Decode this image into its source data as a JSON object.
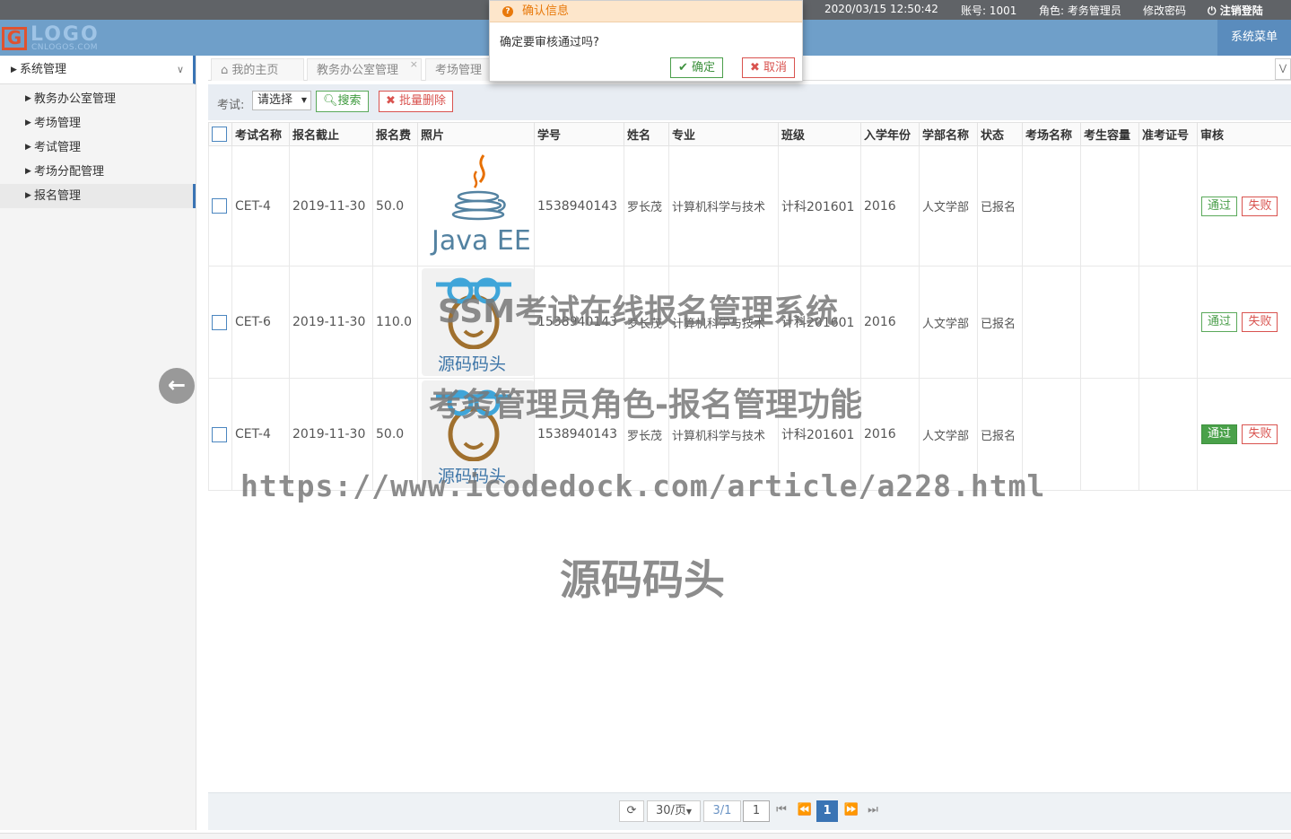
{
  "topbar": {
    "datetime": "2020/03/15 12:50:42",
    "account": "账号: 1001",
    "role": "角色: 考务管理员",
    "change_password": "修改密码",
    "logout": "注销登陆"
  },
  "header": {
    "logo_text": "LOGO",
    "logo_sub": "CNLOGOS.COM",
    "system_menu": "系统菜单"
  },
  "sidebar": {
    "section": "系统管理",
    "items": [
      "教务办公室管理",
      "考场管理",
      "考试管理",
      "考场分配管理",
      "报名管理"
    ]
  },
  "tabs": [
    "我的主页",
    "教务办公室管理",
    "考场管理"
  ],
  "toolbar": {
    "exam_label": "考试:",
    "exam_select": "请选择",
    "search": "搜索",
    "batch_delete": "批量删除"
  },
  "table": {
    "columns": [
      "考试名称",
      "报名截止",
      "报名费",
      "照片",
      "学号",
      "姓名",
      "专业",
      "班级",
      "入学年份",
      "学部名称",
      "状态",
      "考场名称",
      "考生容量",
      "准考证号",
      "审核"
    ],
    "rows": [
      {
        "exam": "CET-4",
        "deadline": "2019-11-30",
        "fee": "50.0",
        "photo": "Java EE",
        "student_id": "1538940143",
        "name": "罗长茂",
        "major": "计算机科学与技术",
        "class": "计科201601",
        "year": "2016",
        "dept": "人文学部",
        "status": "已报名",
        "room": "",
        "capacity": "",
        "ticket": ""
      },
      {
        "exam": "CET-6",
        "deadline": "2019-11-30",
        "fee": "110.0",
        "photo": "源码码头",
        "student_id": "1538940143",
        "name": "罗长茂",
        "major": "计算机科学与技术",
        "class": "计科201601",
        "year": "2016",
        "dept": "人文学部",
        "status": "已报名",
        "room": "",
        "capacity": "",
        "ticket": ""
      },
      {
        "exam": "CET-4",
        "deadline": "2019-11-30",
        "fee": "50.0",
        "photo": "源码码头",
        "student_id": "1538940143",
        "name": "罗长茂",
        "major": "计算机科学与技术",
        "class": "计科201601",
        "year": "2016",
        "dept": "人文学部",
        "status": "已报名",
        "room": "",
        "capacity": "",
        "ticket": ""
      }
    ],
    "pass_label": "通过",
    "fail_label": "失败"
  },
  "pager": {
    "page_size": "30/页",
    "page_info": "3/1",
    "page_input": "1",
    "current_page": "1"
  },
  "dialog": {
    "title": "确认信息",
    "message": "确定要审核通过吗?",
    "ok": "确定",
    "cancel": "取消"
  },
  "watermark": {
    "line1": "SSM考试在线报名管理系统",
    "line2": "考务管理员角色-报名管理功能",
    "url": "https://www.icodedock.com/article/a228.html",
    "brand": "源码码头"
  },
  "colors": {
    "header_bg": "#6f9fc9",
    "topbar_bg": "#606367",
    "accent_blue": "#3a74b4",
    "success_green": "#4aa14a",
    "danger_red": "#d9534f",
    "dialog_header": "#fde6cb"
  }
}
